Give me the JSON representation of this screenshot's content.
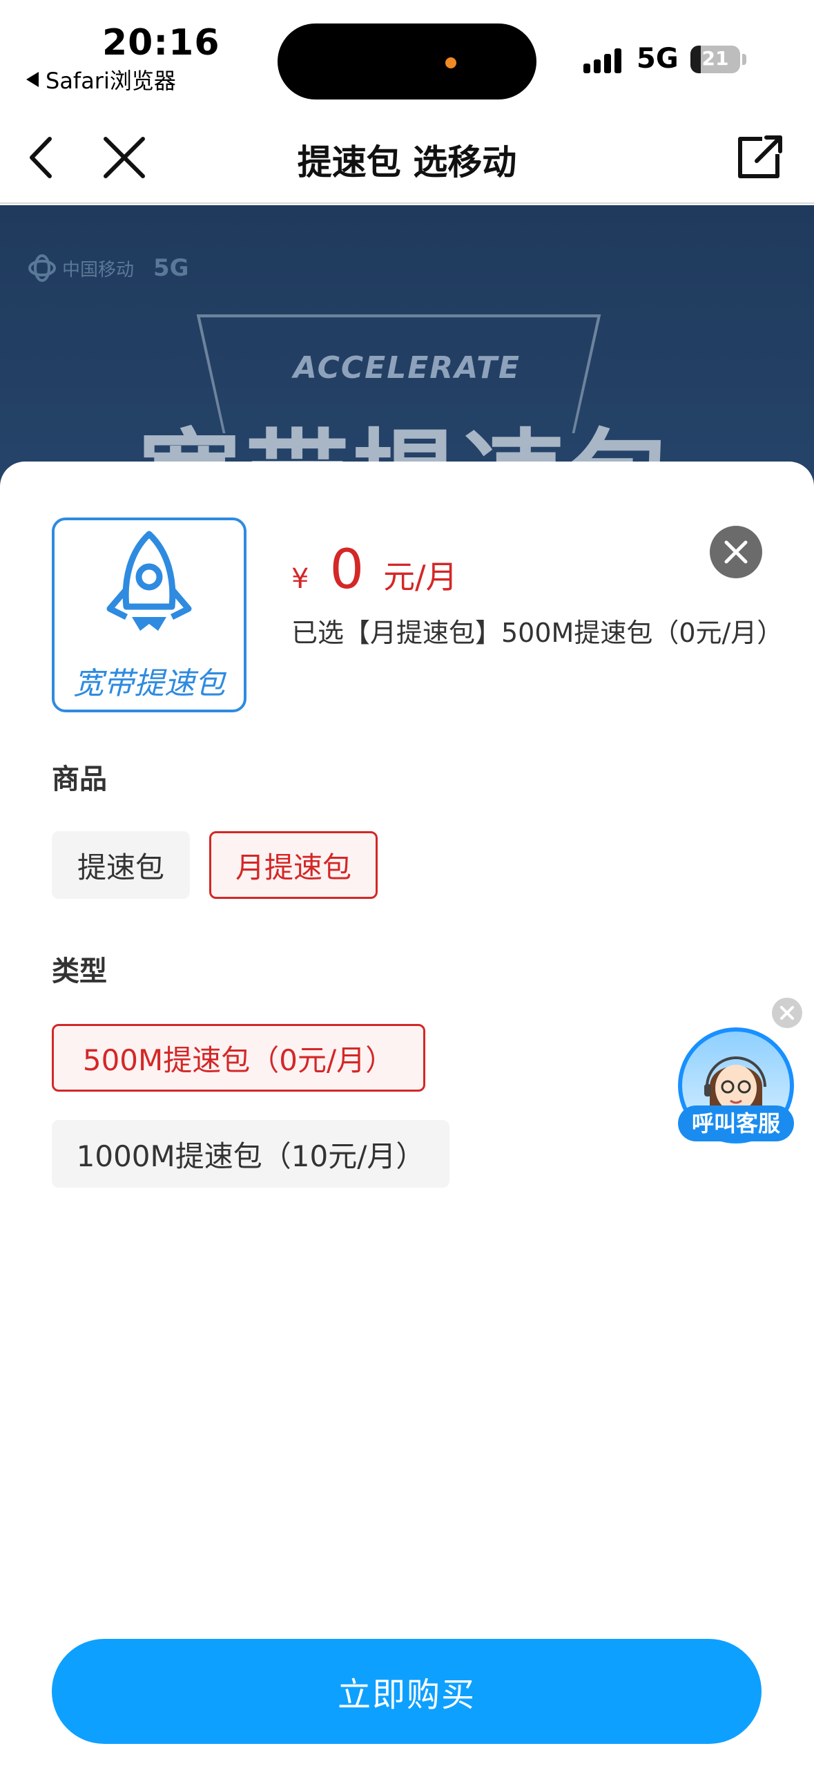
{
  "status_bar": {
    "time": "20:16",
    "back_app": "Safari浏览器",
    "network": "5G",
    "battery": "21",
    "battery_level": 0.21
  },
  "nav": {
    "title": "提速包 选移动",
    "icons": [
      "chevron-left-icon",
      "close-icon",
      "share-icon"
    ]
  },
  "banner": {
    "logo_text": "中国移动",
    "logo_badge": "5G",
    "accent_text": "ACCELERATE",
    "headline": "宽带提速包"
  },
  "product": {
    "thumb_label": "宽带提速包",
    "currency": "¥",
    "price": "0",
    "unit": "元/月",
    "selected_text": "已选【月提速包】500M提速包（0元/月）"
  },
  "sections": {
    "goods_title": "商品",
    "goods_options": [
      "提速包",
      "月提速包"
    ],
    "goods_selected": "月提速包",
    "type_title": "类型",
    "type_options": [
      "500M提速包（0元/月）",
      "1000M提速包（10元/月）"
    ],
    "type_selected": "500M提速包（0元/月）"
  },
  "service": {
    "label": "呼叫客服"
  },
  "actions": {
    "buy": "立即购买"
  },
  "colors": {
    "accent_red": "#d42727",
    "primary_blue": "#0ea0ff",
    "thumb_blue": "#2e8be0"
  }
}
